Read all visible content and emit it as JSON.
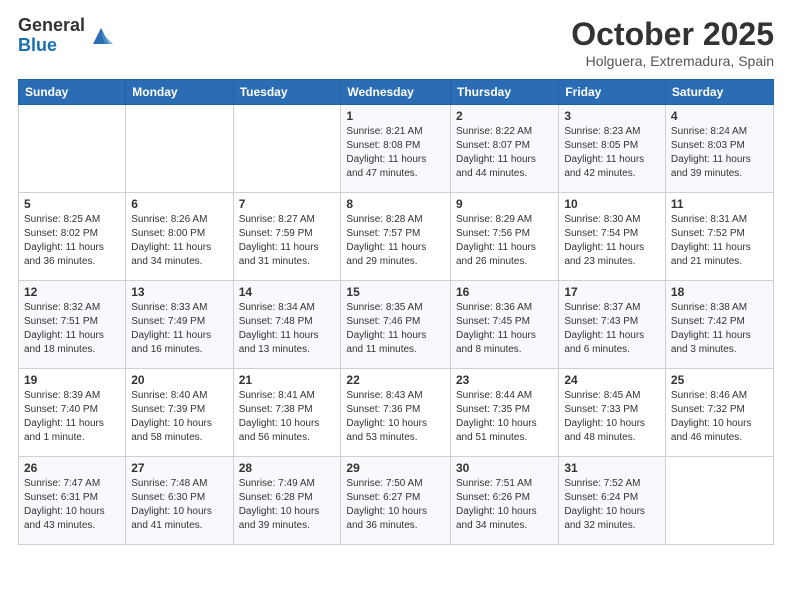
{
  "logo": {
    "general": "General",
    "blue": "Blue"
  },
  "title": "October 2025",
  "location": "Holguera, Extremadura, Spain",
  "days_of_week": [
    "Sunday",
    "Monday",
    "Tuesday",
    "Wednesday",
    "Thursday",
    "Friday",
    "Saturday"
  ],
  "weeks": [
    [
      {
        "day": "",
        "info": ""
      },
      {
        "day": "",
        "info": ""
      },
      {
        "day": "",
        "info": ""
      },
      {
        "day": "1",
        "info": "Sunrise: 8:21 AM\nSunset: 8:08 PM\nDaylight: 11 hours and 47 minutes."
      },
      {
        "day": "2",
        "info": "Sunrise: 8:22 AM\nSunset: 8:07 PM\nDaylight: 11 hours and 44 minutes."
      },
      {
        "day": "3",
        "info": "Sunrise: 8:23 AM\nSunset: 8:05 PM\nDaylight: 11 hours and 42 minutes."
      },
      {
        "day": "4",
        "info": "Sunrise: 8:24 AM\nSunset: 8:03 PM\nDaylight: 11 hours and 39 minutes."
      }
    ],
    [
      {
        "day": "5",
        "info": "Sunrise: 8:25 AM\nSunset: 8:02 PM\nDaylight: 11 hours and 36 minutes."
      },
      {
        "day": "6",
        "info": "Sunrise: 8:26 AM\nSunset: 8:00 PM\nDaylight: 11 hours and 34 minutes."
      },
      {
        "day": "7",
        "info": "Sunrise: 8:27 AM\nSunset: 7:59 PM\nDaylight: 11 hours and 31 minutes."
      },
      {
        "day": "8",
        "info": "Sunrise: 8:28 AM\nSunset: 7:57 PM\nDaylight: 11 hours and 29 minutes."
      },
      {
        "day": "9",
        "info": "Sunrise: 8:29 AM\nSunset: 7:56 PM\nDaylight: 11 hours and 26 minutes."
      },
      {
        "day": "10",
        "info": "Sunrise: 8:30 AM\nSunset: 7:54 PM\nDaylight: 11 hours and 23 minutes."
      },
      {
        "day": "11",
        "info": "Sunrise: 8:31 AM\nSunset: 7:52 PM\nDaylight: 11 hours and 21 minutes."
      }
    ],
    [
      {
        "day": "12",
        "info": "Sunrise: 8:32 AM\nSunset: 7:51 PM\nDaylight: 11 hours and 18 minutes."
      },
      {
        "day": "13",
        "info": "Sunrise: 8:33 AM\nSunset: 7:49 PM\nDaylight: 11 hours and 16 minutes."
      },
      {
        "day": "14",
        "info": "Sunrise: 8:34 AM\nSunset: 7:48 PM\nDaylight: 11 hours and 13 minutes."
      },
      {
        "day": "15",
        "info": "Sunrise: 8:35 AM\nSunset: 7:46 PM\nDaylight: 11 hours and 11 minutes."
      },
      {
        "day": "16",
        "info": "Sunrise: 8:36 AM\nSunset: 7:45 PM\nDaylight: 11 hours and 8 minutes."
      },
      {
        "day": "17",
        "info": "Sunrise: 8:37 AM\nSunset: 7:43 PM\nDaylight: 11 hours and 6 minutes."
      },
      {
        "day": "18",
        "info": "Sunrise: 8:38 AM\nSunset: 7:42 PM\nDaylight: 11 hours and 3 minutes."
      }
    ],
    [
      {
        "day": "19",
        "info": "Sunrise: 8:39 AM\nSunset: 7:40 PM\nDaylight: 11 hours and 1 minute."
      },
      {
        "day": "20",
        "info": "Sunrise: 8:40 AM\nSunset: 7:39 PM\nDaylight: 10 hours and 58 minutes."
      },
      {
        "day": "21",
        "info": "Sunrise: 8:41 AM\nSunset: 7:38 PM\nDaylight: 10 hours and 56 minutes."
      },
      {
        "day": "22",
        "info": "Sunrise: 8:43 AM\nSunset: 7:36 PM\nDaylight: 10 hours and 53 minutes."
      },
      {
        "day": "23",
        "info": "Sunrise: 8:44 AM\nSunset: 7:35 PM\nDaylight: 10 hours and 51 minutes."
      },
      {
        "day": "24",
        "info": "Sunrise: 8:45 AM\nSunset: 7:33 PM\nDaylight: 10 hours and 48 minutes."
      },
      {
        "day": "25",
        "info": "Sunrise: 8:46 AM\nSunset: 7:32 PM\nDaylight: 10 hours and 46 minutes."
      }
    ],
    [
      {
        "day": "26",
        "info": "Sunrise: 7:47 AM\nSunset: 6:31 PM\nDaylight: 10 hours and 43 minutes."
      },
      {
        "day": "27",
        "info": "Sunrise: 7:48 AM\nSunset: 6:30 PM\nDaylight: 10 hours and 41 minutes."
      },
      {
        "day": "28",
        "info": "Sunrise: 7:49 AM\nSunset: 6:28 PM\nDaylight: 10 hours and 39 minutes."
      },
      {
        "day": "29",
        "info": "Sunrise: 7:50 AM\nSunset: 6:27 PM\nDaylight: 10 hours and 36 minutes."
      },
      {
        "day": "30",
        "info": "Sunrise: 7:51 AM\nSunset: 6:26 PM\nDaylight: 10 hours and 34 minutes."
      },
      {
        "day": "31",
        "info": "Sunrise: 7:52 AM\nSunset: 6:24 PM\nDaylight: 10 hours and 32 minutes."
      },
      {
        "day": "",
        "info": ""
      }
    ]
  ]
}
